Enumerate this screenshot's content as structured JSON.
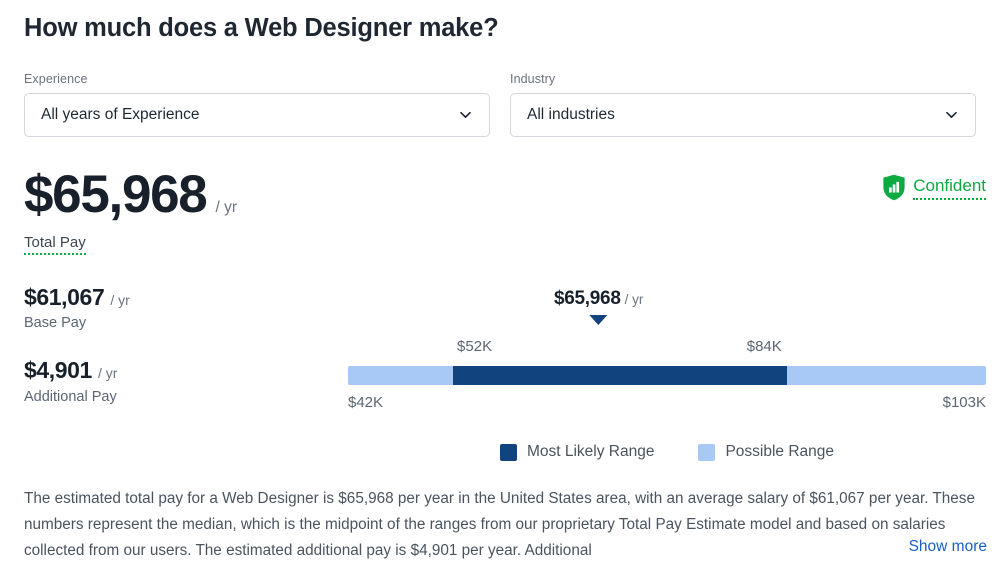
{
  "header": {
    "title": "How much does a Web Designer make?"
  },
  "filters": [
    {
      "label": "Experience",
      "value": "All years of Experience",
      "icon": "chevron-down-icon"
    },
    {
      "label": "Industry",
      "value": "All industries",
      "icon": "chevron-down-icon"
    }
  ],
  "total_pay": {
    "amount": "$65,968",
    "period": "/ yr",
    "caption": "Total Pay"
  },
  "confidence": {
    "label": "Confident",
    "icon": "shield-chart-icon",
    "color": "#0caa41"
  },
  "breakdown": [
    {
      "amount": "$61,067",
      "period": "/ yr",
      "caption": "Base Pay"
    },
    {
      "amount": "$4,901",
      "period": "/ yr",
      "caption": "Additional Pay"
    }
  ],
  "chart_data": {
    "type": "bar",
    "title": "Web Designer total pay range",
    "orientation": "horizontal",
    "xlim": [
      42000,
      103000
    ],
    "grid": false,
    "axis_min_label": "$42K",
    "axis_max_label": "$103K",
    "median_label": "$65,968",
    "median_period": "/ yr",
    "median_value": 65968,
    "likely_low_label": "$52K",
    "likely_high_label": "$84K",
    "likely_low_value": 52000,
    "likely_high_value": 84000,
    "possible_low_value": 42000,
    "possible_high_value": 103000,
    "series": [
      {
        "name": "Most Likely Range",
        "color": "#11437f",
        "low": 52000,
        "high": 84000
      },
      {
        "name": "Possible Range",
        "color": "#a8c8f5",
        "low": 42000,
        "high": 103000
      }
    ],
    "legend": [
      {
        "label": "Most Likely Range",
        "color": "#11437f"
      },
      {
        "label": "Possible Range",
        "color": "#a8c8f5"
      }
    ],
    "legend_position": "bottom-center"
  },
  "description": {
    "text": "The estimated total pay for a Web Designer is $65,968 per year in the United States area, with an average salary of $61,067 per year. These numbers represent the median, which is the midpoint of the ranges from our proprietary Total Pay Estimate model and based on salaries collected from our users. The estimated additional pay is $4,901 per year. Additional",
    "show_more": "Show more"
  }
}
